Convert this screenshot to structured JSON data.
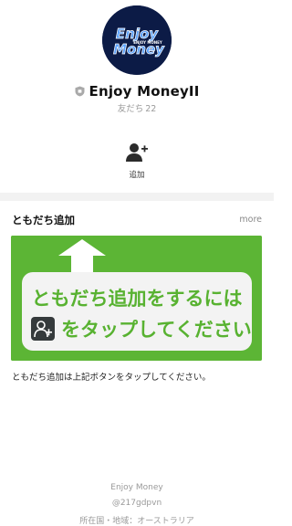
{
  "profile": {
    "logo_text_line1": "Enjoy",
    "logo_text_line2": "Money",
    "logo_text_small": "ENJOY MONEY",
    "name": "Enjoy MoneyII",
    "friends_label": "友だち",
    "friends_count": "22"
  },
  "actions": {
    "add_friend_label": "追加"
  },
  "section": {
    "title": "ともだち追加",
    "more_label": "more"
  },
  "banner": {
    "line1": "ともだち追加をするには",
    "line2": "をタップしてください",
    "background_color": "#5cb535"
  },
  "description": "ともだち追加は上記ボタンをタップしてください。",
  "footer": {
    "name": "Enjoy Money",
    "id": "@217gdpvn",
    "location": "所在国・地域：オーストラリア"
  }
}
